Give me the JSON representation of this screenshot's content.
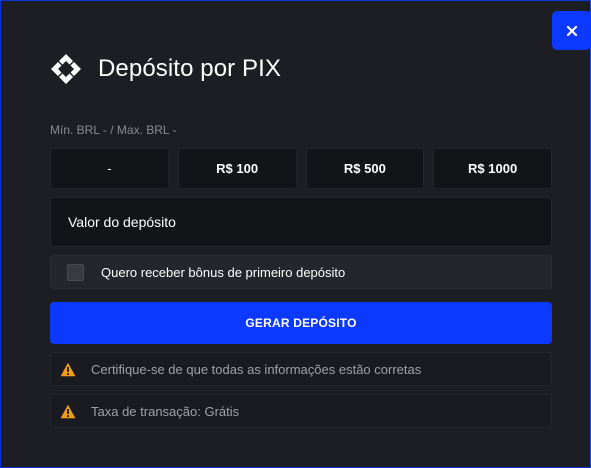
{
  "modal": {
    "title": "Depósito por PIX",
    "close_label": "×",
    "limits_text": "Mín. BRL - / Max. BRL -",
    "amount_options": [
      "-",
      "R$ 100",
      "R$ 500",
      "R$ 1000"
    ],
    "deposit_value_label": "Valor do depósito",
    "bonus_checkbox_label": "Quero receber bônus de primeiro depósito",
    "bonus_checked": false,
    "generate_button_label": "GERAR DEPÓSITO",
    "notices": [
      "Certifique-se de que todas as informações estão corretas",
      "Taxa de transação: Grátis"
    ]
  },
  "colors": {
    "accent": "#0c39ff",
    "background": "#1d1e23",
    "warning": "#f39c12"
  }
}
